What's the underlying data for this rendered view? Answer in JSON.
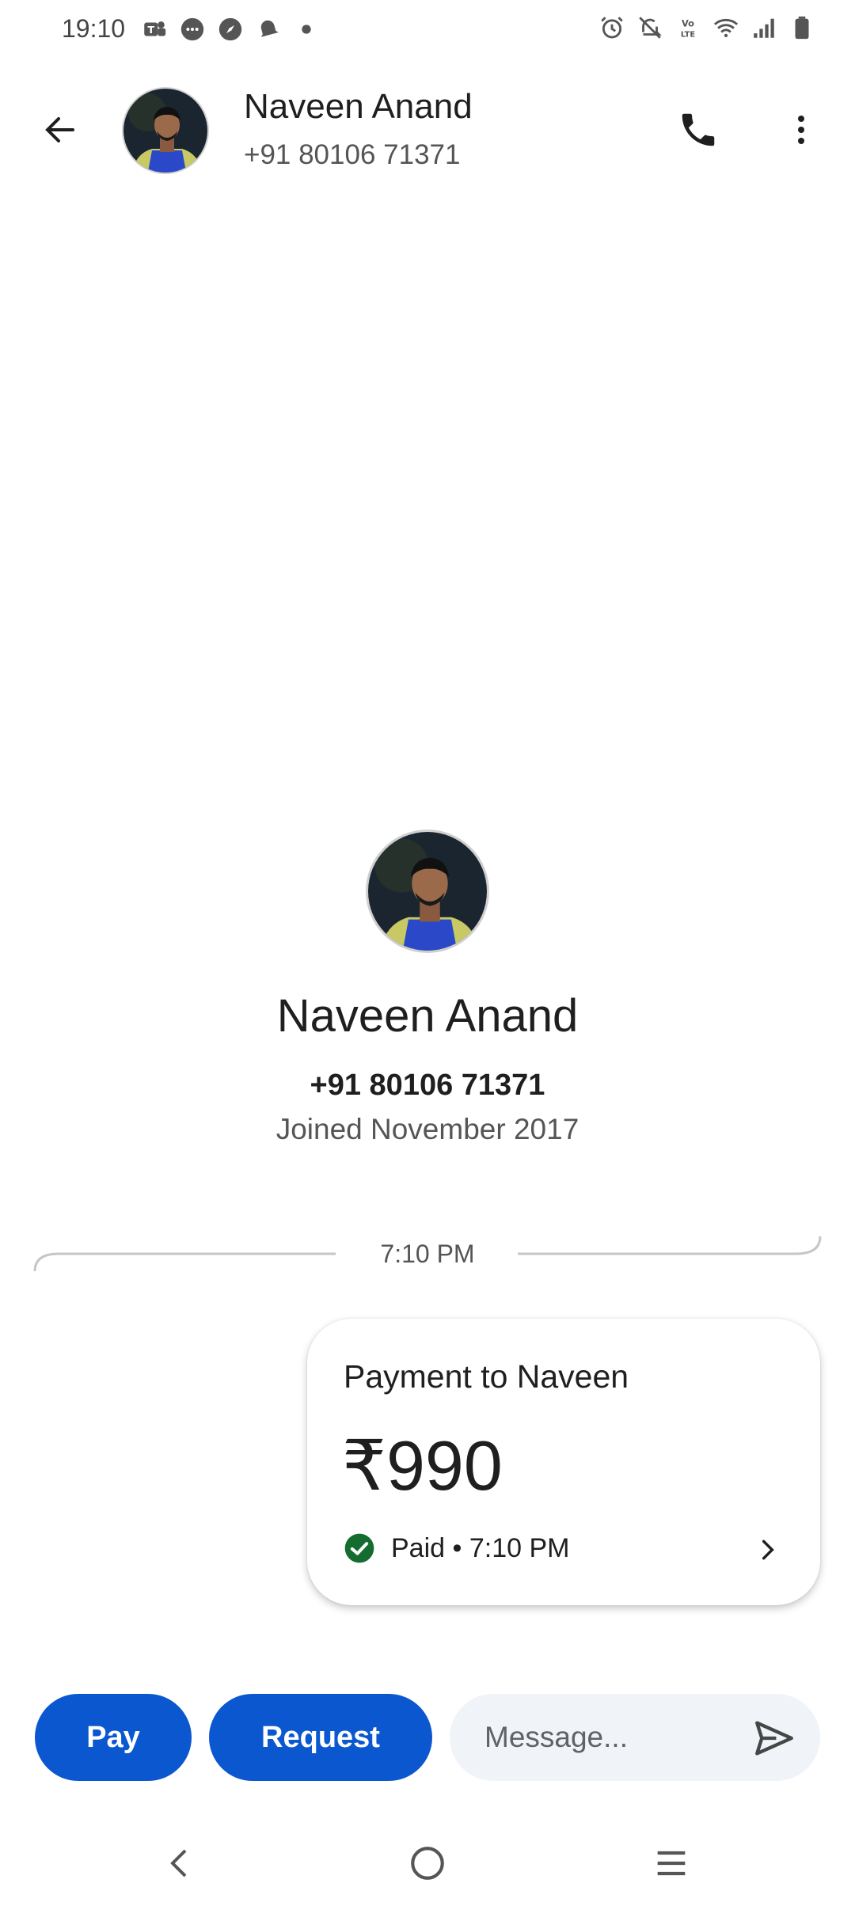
{
  "status_bar": {
    "time": "19:10",
    "left_icons": [
      "teams-icon",
      "chat-icon",
      "compass-icon",
      "bell-icon",
      "dot-icon"
    ],
    "right_icons": [
      "alarm-icon",
      "mute-icon",
      "volte-icon",
      "wifi-icon",
      "signal-icon",
      "battery-icon"
    ]
  },
  "header": {
    "contact_name": "Naveen Anand",
    "contact_phone": "+91 80106 71371",
    "icons": [
      "back-arrow-icon",
      "phone-icon",
      "more-vertical-icon"
    ]
  },
  "profile": {
    "name": "Naveen Anand",
    "phone": "+91 80106 71371",
    "joined": "Joined November 2017"
  },
  "timeline": {
    "time": "7:10 PM"
  },
  "payment": {
    "title": "Payment to Naveen",
    "amount": "₹990",
    "status": "Paid • 7:10 PM",
    "status_color": "#146c2e"
  },
  "actions": {
    "pay_label": "Pay",
    "request_label": "Request",
    "message_placeholder": "Message...",
    "accent_color": "#0b57d0"
  },
  "nav_bar": {
    "icons": [
      "nav-back-icon",
      "nav-home-icon",
      "nav-recents-icon"
    ]
  }
}
